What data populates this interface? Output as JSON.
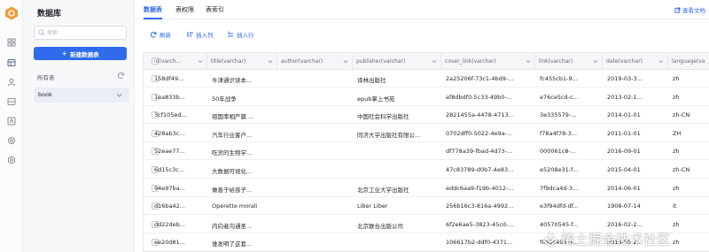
{
  "sidebar": {
    "title": "数据库",
    "search_placeholder": "搜索",
    "new_button": "新建数据表",
    "all_label": "所有表",
    "database_name": "book"
  },
  "tabs": [
    {
      "label": "数据表",
      "active": true
    },
    {
      "label": "表权限",
      "active": false
    },
    {
      "label": "表索引",
      "active": false
    }
  ],
  "docs_link": "查看文档",
  "toolbar": {
    "refresh": "刷新",
    "insert_column": "插入列",
    "insert_row": "插入行"
  },
  "table": {
    "columns": [
      "id(varch...",
      "title(varchar)",
      "author(varchar)",
      "publisher(varchar)",
      "cover_link(varchar)",
      "link(varchar)",
      "date(varchar)",
      "language(va"
    ],
    "rows": [
      [
        "158df49...",
        "牛津通识读本...",
        "",
        "译林出版社",
        "2a25206f-73c1-4bd9-...",
        "fc455cb1-9...",
        "2019-03-3...",
        "zh"
      ],
      [
        "1ea833b...",
        "50年战争",
        "",
        "epub掌上书苑",
        "af8dbdf0-5c33-49b0-...",
        "e76ce5cd-c...",
        "2013-02-1...",
        "zh"
      ],
      [
        "3cf105ed...",
        "祖国率相严篇 ...",
        "",
        "中国社会科学出版社",
        "2821455a-4478-4713...",
        "3e335579-...",
        "2014-01-01",
        "zh-CN"
      ],
      [
        "428ab3c...",
        "汽车行业客户...",
        "",
        "同济大学出版社有限公...",
        "0702dff0-5022-4e9a-...",
        "f78a4f78-3...",
        "2011-01-01",
        "ZH"
      ],
      [
        "52eae77...",
        "吃货的生物学...",
        "",
        "",
        "df778a39-fbad-4d73-...",
        "000061c8-...",
        "2016-09-01",
        "zh"
      ],
      [
        "6d15c3c...",
        "大数据可视化...",
        "",
        "",
        "47c83789-d0b7-4e83...",
        "e5208e31-f...",
        "2015-04-01",
        "zh-CN"
      ],
      [
        "94e97ba...",
        "做善于给孩子...",
        "",
        "北京工业大学出版社",
        "eddc6aa9-f19b-4012-...",
        "7f9dca4d-3...",
        "2014-06-01",
        "zh"
      ],
      [
        "d16ba42...",
        "Operette morali",
        "",
        "Liber Liber",
        "256b16c3-816a-4992...",
        "e3f94dfd-df...",
        "1908-07-14",
        "it"
      ],
      [
        "dd22deb...",
        "内向者沟通圣...",
        "",
        "北京联合出版公司",
        "6f2e6ae5-3823-45cd-...",
        "40570545-f...",
        "2016-02-2...",
        "zh"
      ],
      [
        "ee20d81...",
        "谁发明了这套...",
        "",
        "",
        "106617b2-ddf0-4371...",
        "f0a3c493-6...",
        "2016-05-2...",
        "zh"
      ]
    ]
  },
  "watermark": "稀土掘金技术社区",
  "colors": {
    "accent": "#2f6bea",
    "logo": "#f29a38"
  }
}
